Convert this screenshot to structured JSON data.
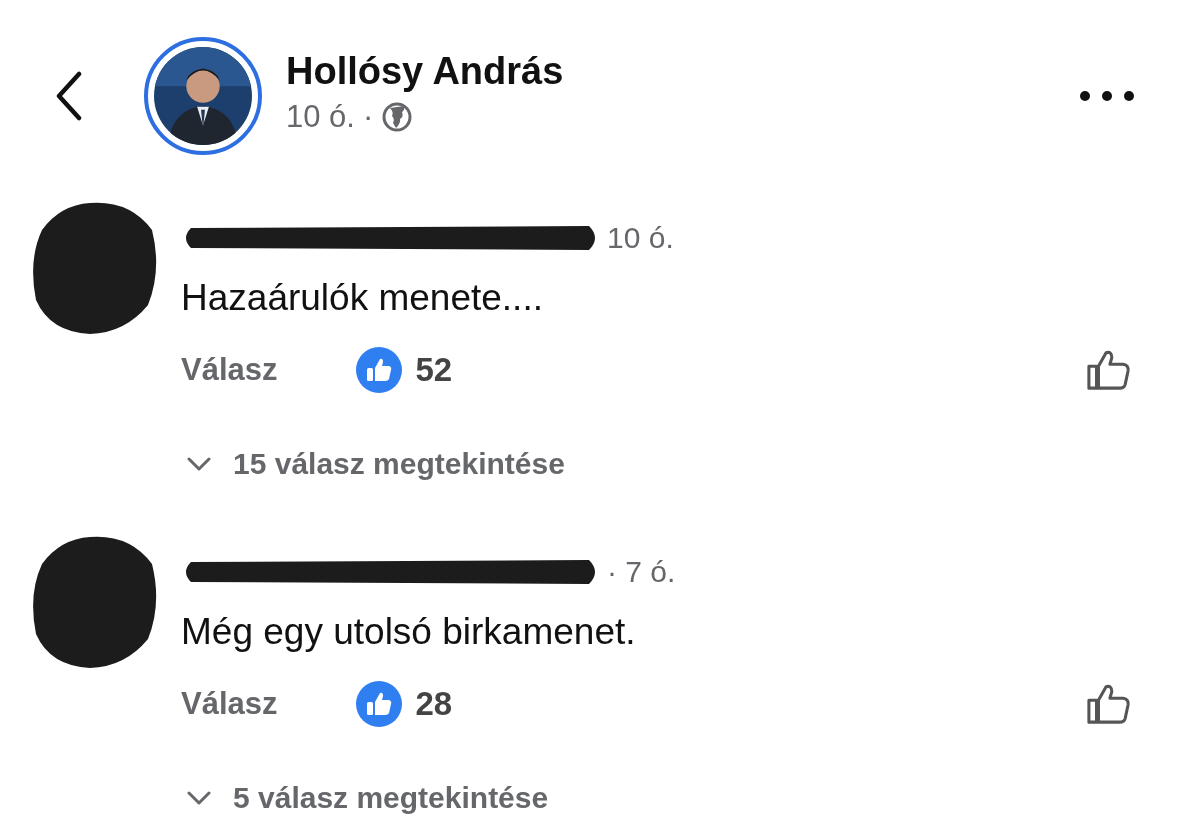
{
  "post_author": {
    "name": "Hollósy András",
    "time": "10 ó.",
    "separator": "·"
  },
  "comments": [
    {
      "time": "10 ó.",
      "text": "Hazaárulók menete....",
      "reply_label": "Válasz",
      "like_count": "52",
      "replies_link": "15 válasz megtekintése"
    },
    {
      "time": "· 7 ó.",
      "text": "Még egy utolsó birkamenet.",
      "reply_label": "Válasz",
      "like_count": "28",
      "replies_link": "5 válasz megtekintése"
    }
  ]
}
